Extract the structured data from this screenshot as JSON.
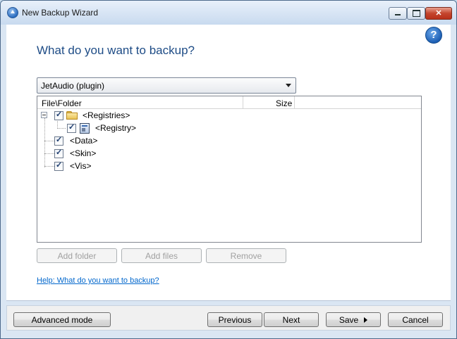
{
  "window": {
    "title": "New Backup Wizard"
  },
  "titlebar": {
    "min_glyph": "",
    "max_glyph": "",
    "close_glyph": "✕"
  },
  "help_icon_glyph": "?",
  "heading": "What do you want to backup?",
  "source_combo": {
    "value": "JetAudio (plugin)"
  },
  "list": {
    "columns": [
      "File\\Folder",
      "Size"
    ],
    "rows": [
      {
        "label": "<Registries>",
        "checked": true,
        "icon": "folder-icon",
        "expanded": true
      },
      {
        "label": "<Registry>",
        "checked": true,
        "icon": "registry-icon"
      },
      {
        "label": "<Data>",
        "checked": true
      },
      {
        "label": "<Skin>",
        "checked": true
      },
      {
        "label": "<Vis>",
        "checked": true
      }
    ]
  },
  "list_buttons": {
    "add_folder": "Add folder",
    "add_files": "Add files",
    "remove": "Remove"
  },
  "help_link": "Help: What do you want to backup?",
  "footer": {
    "advanced_mode": "Advanced mode",
    "previous": "Previous",
    "next": "Next",
    "save": "Save",
    "cancel": "Cancel"
  },
  "colors": {
    "heading": "#1e4c86",
    "link": "#0066cc",
    "frame": "#dae6f3"
  }
}
